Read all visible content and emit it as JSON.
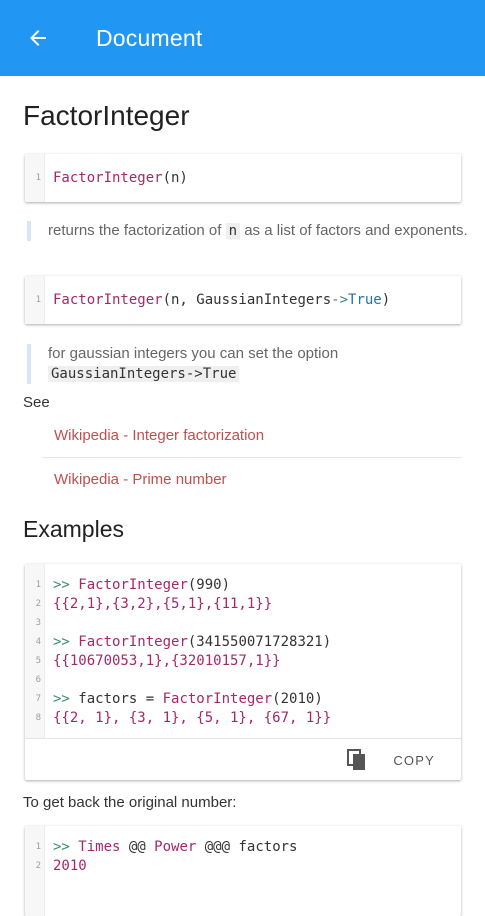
{
  "appbar": {
    "title": "Document",
    "back_icon": "arrow-back-icon"
  },
  "doc": {
    "title": "FactorInteger",
    "sig1": {
      "line": "1",
      "fn": "FactorInteger",
      "args": "(n)"
    },
    "desc1_pre": "returns the factorization of ",
    "desc1_code": "n",
    "desc1_post": " as a list of factors and exponents.",
    "sig2": {
      "line": "1",
      "fn": "FactorInteger",
      "args_pre": "(n, GaussianIntegers",
      "arrow": "->",
      "val": "True",
      "close": ")"
    },
    "desc2": "for gaussian integers you can set the option",
    "desc2_code": "GaussianIntegers->True",
    "see_label": "See",
    "links": [
      {
        "label": "Wikipedia - Integer factorization"
      },
      {
        "label": "Wikipedia - Prime number"
      }
    ],
    "examples_title": "Examples",
    "example_lines": [
      {
        "n": "1",
        "prompt": ">> ",
        "fn": "FactorInteger",
        "rest": "(990)"
      },
      {
        "n": "2",
        "text": "{{2,1},{3,2},{5,1},{11,1}}"
      },
      {
        "n": "3",
        "text": ""
      },
      {
        "n": "4",
        "prompt": ">> ",
        "fn": "FactorInteger",
        "rest": "(341550071728321)"
      },
      {
        "n": "5",
        "text": "{{10670053,1},{32010157,1}}"
      },
      {
        "n": "6",
        "text": ""
      },
      {
        "n": "7",
        "prompt": ">> ",
        "pre": "factors = ",
        "fn": "FactorInteger",
        "rest": "(2010)"
      },
      {
        "n": "8",
        "text": "{{2, 1}, {3, 1}, {5, 1}, {67, 1}}"
      }
    ],
    "copy_label": "COPY",
    "copy_icon": "content-copy-icon",
    "back_text": "To get back the original number:",
    "power_lines": [
      {
        "n": "1",
        "prompt": ">> ",
        "fn1": "Times",
        "op1": " @@ ",
        "fn2": "Power",
        "op2": " @@@ ",
        "rest": "factors"
      },
      {
        "n": "2",
        "text": "2010"
      }
    ]
  }
}
